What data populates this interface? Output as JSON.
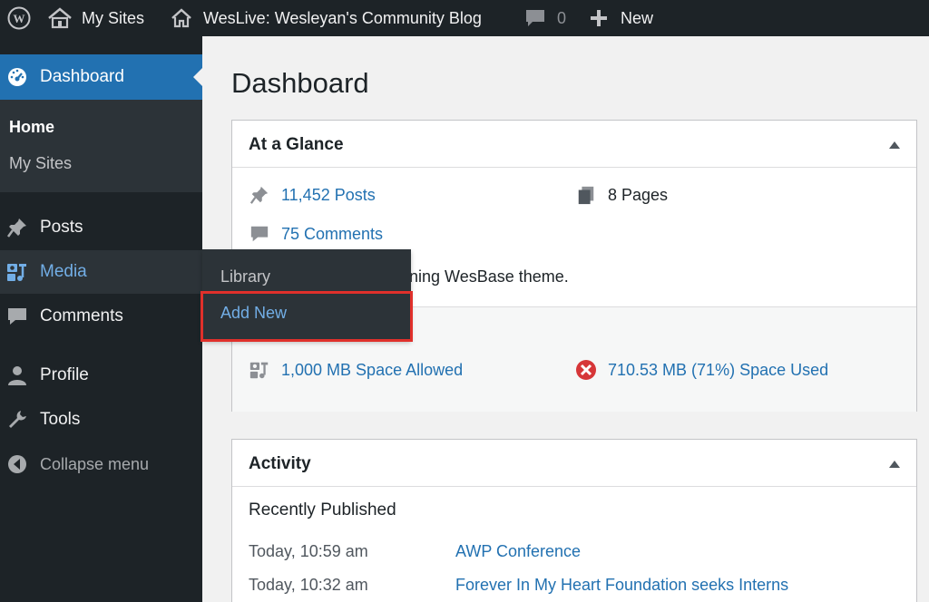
{
  "admin_bar": {
    "my_sites_label": "My Sites",
    "site_name": "WesLive: Wesleyan's Community Blog",
    "comments_count": "0",
    "new_label": "New"
  },
  "sidebar": {
    "dashboard_label": "Dashboard",
    "dashboard_sub": {
      "home_label": "Home",
      "my_sites_label": "My Sites"
    },
    "items": [
      {
        "label": "Posts",
        "icon": "pushpin-icon"
      },
      {
        "label": "Media",
        "icon": "media-icon"
      },
      {
        "label": "Comments",
        "icon": "comment-icon"
      },
      {
        "label": "Profile",
        "icon": "user-icon"
      },
      {
        "label": "Tools",
        "icon": "wrench-icon"
      },
      {
        "label": "Collapse menu",
        "icon": "collapse-arrow-icon"
      }
    ]
  },
  "media_flyout": {
    "library_label": "Library",
    "add_new_label": "Add New"
  },
  "main": {
    "page_title": "Dashboard",
    "at_a_glance": {
      "title": "At a Glance",
      "posts": "11,452 Posts",
      "pages": "8 Pages",
      "comments": "75 Comments",
      "theme_text": "ning WesBase theme.",
      "space_allowed": "1,000 MB Space Allowed",
      "space_used": "710.53 MB (71%) Space Used"
    },
    "activity": {
      "title": "Activity",
      "recently_published_label": "Recently Published",
      "posts": [
        {
          "date": "Today, 10:59 am",
          "title": "AWP Conference"
        },
        {
          "date": "Today, 10:32 am",
          "title": "Forever In My Heart Foundation seeks Interns"
        }
      ]
    }
  },
  "colors": {
    "admin_bg": "#1d2327",
    "menu_active": "#2271b1",
    "submenu_bg": "#2c3338",
    "link": "#2271b1",
    "highlight_box": "#e0302b",
    "error_icon": "#d63638"
  }
}
